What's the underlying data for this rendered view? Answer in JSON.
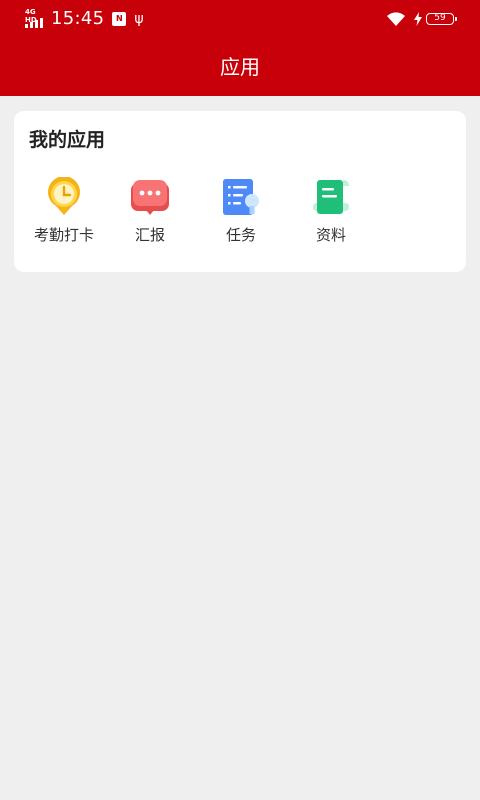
{
  "status_bar": {
    "network": "4G HD",
    "time": "15:45",
    "nfc": "N",
    "usb": "ψ",
    "battery": "59"
  },
  "header": {
    "title": "应用"
  },
  "my_apps": {
    "title": "我的应用",
    "items": [
      {
        "label": "考勤打卡",
        "icon": "clock-pin-icon"
      },
      {
        "label": "汇报",
        "icon": "chat-bubble-icon"
      },
      {
        "label": "任务",
        "icon": "task-list-icon"
      },
      {
        "label": "资料",
        "icon": "document-icon"
      }
    ]
  },
  "colors": {
    "brand_red": "#c8000a",
    "background": "#efefef",
    "card": "#ffffff"
  }
}
